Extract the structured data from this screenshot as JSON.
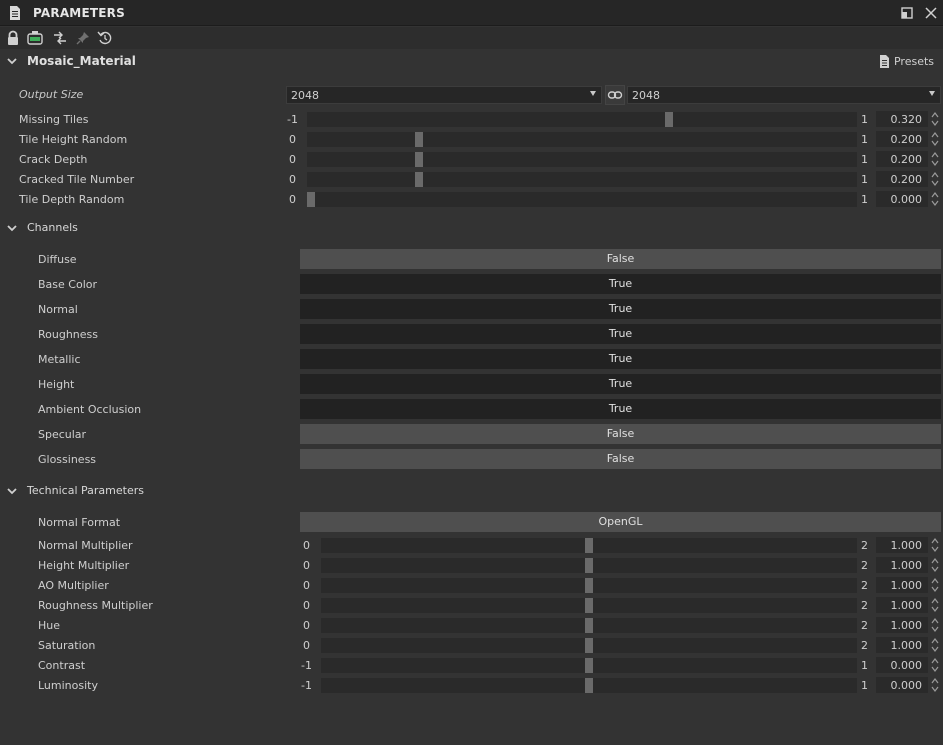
{
  "panel": {
    "title": "PARAMETERS"
  },
  "material": {
    "name": "Mosaic_Material",
    "presets_label": "Presets"
  },
  "output_size": {
    "label": "Output Size",
    "width": "2048",
    "height": "2048"
  },
  "sliders": [
    {
      "label": "Missing Tiles",
      "min": "-1",
      "max": "1",
      "value": "0.320",
      "fraction": 0.66
    },
    {
      "label": "Tile Height Random",
      "min": "0",
      "max": "1",
      "value": "0.200",
      "fraction": 0.2
    },
    {
      "label": "Crack Depth",
      "min": "0",
      "max": "1",
      "value": "0.200",
      "fraction": 0.2
    },
    {
      "label": "Cracked Tile Number",
      "min": "0",
      "max": "1",
      "value": "0.200",
      "fraction": 0.2
    },
    {
      "label": "Tile Depth Random",
      "min": "0",
      "max": "1",
      "value": "0.000",
      "fraction": 0.0
    }
  ],
  "channels": {
    "header": "Channels",
    "items": [
      {
        "label": "Diffuse",
        "value": "False"
      },
      {
        "label": "Base Color",
        "value": "True"
      },
      {
        "label": "Normal",
        "value": "True"
      },
      {
        "label": "Roughness",
        "value": "True"
      },
      {
        "label": "Metallic",
        "value": "True"
      },
      {
        "label": "Height",
        "value": "True"
      },
      {
        "label": "Ambient Occlusion",
        "value": "True"
      },
      {
        "label": "Specular",
        "value": "False"
      },
      {
        "label": "Glossiness",
        "value": "False"
      }
    ]
  },
  "technical": {
    "header": "Technical Parameters",
    "normal_format": {
      "label": "Normal Format",
      "value": "OpenGL"
    },
    "sliders": [
      {
        "label": "Normal Multiplier",
        "min": "0",
        "max": "2",
        "value": "1.000",
        "fraction": 0.5
      },
      {
        "label": "Height Multiplier",
        "min": "0",
        "max": "2",
        "value": "1.000",
        "fraction": 0.5
      },
      {
        "label": "AO Multiplier",
        "min": "0",
        "max": "2",
        "value": "1.000",
        "fraction": 0.5
      },
      {
        "label": "Roughness Multiplier",
        "min": "0",
        "max": "2",
        "value": "1.000",
        "fraction": 0.5
      },
      {
        "label": "Hue",
        "min": "0",
        "max": "2",
        "value": "1.000",
        "fraction": 0.5
      },
      {
        "label": "Saturation",
        "min": "0",
        "max": "2",
        "value": "1.000",
        "fraction": 0.5
      },
      {
        "label": "Contrast",
        "min": "-1",
        "max": "1",
        "value": "0.000",
        "fraction": 0.5
      },
      {
        "label": "Luminosity",
        "min": "-1",
        "max": "1",
        "value": "0.000",
        "fraction": 0.5
      }
    ]
  },
  "icons": [
    "document-icon",
    "restore-icon",
    "close-icon",
    "lock-icon",
    "shelf-icon",
    "connect-icon",
    "pin-icon",
    "reset-icon",
    "chevron-down-icon",
    "link-icon",
    "presets-icon",
    "spin-icon"
  ]
}
